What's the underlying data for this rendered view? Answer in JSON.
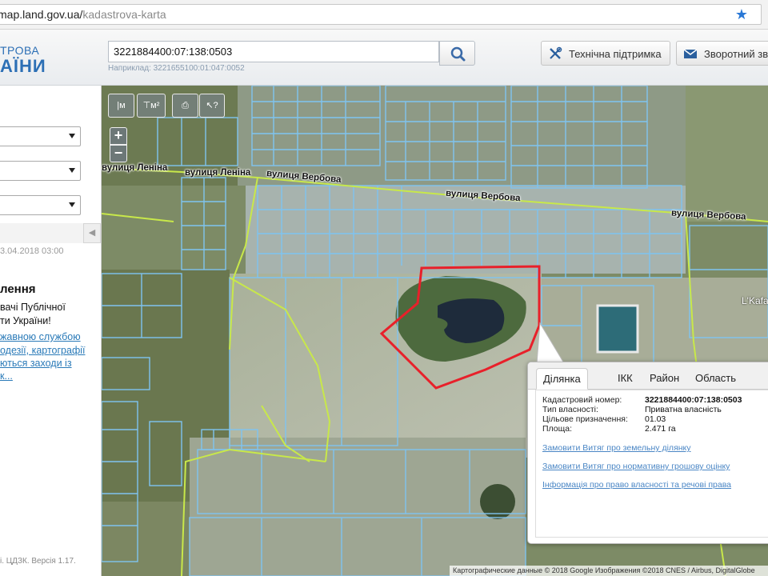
{
  "browser": {
    "url_domain": "map.land.gov.ua/",
    "url_path": "kadastrova-karta"
  },
  "header": {
    "logo_line1": "ТРОВА",
    "logo_line2": "АЇНИ",
    "search_value": "3221884400:07:138:0503",
    "search_example": "Наприклад: 3221655100:01:047:0052",
    "support_label": "Технічна підтримка",
    "feedback_label": "Зворотний зв'"
  },
  "left_panel": {
    "updated_date": "3.04.2018 03:00",
    "notice_title": "лення",
    "notice_line1": "вачі Публічної",
    "notice_line2": "ти України!",
    "notice_link1": "жавною службою",
    "notice_link2": "одезії, картографії",
    "notice_link3": "ються заходи із",
    "notice_link4": "к...",
    "footer": "і. ЦДЗК. Версія 1.17."
  },
  "map": {
    "streets": [
      "вулиця Леніна",
      "вулиця Леніна",
      "вулиця Вербова",
      "вулиця Вербова",
      "вулиця Вербова"
    ],
    "place_label": "L'Kafa",
    "tools": [
      "м",
      "м²",
      "print",
      "info"
    ],
    "attribution": "Картографические данные © 2018 Google Изображения ©2018 CNES / Airbus, DigitalGlobe"
  },
  "popup": {
    "tabs": [
      "Ділянка",
      "ІКК",
      "Район",
      "Область"
    ],
    "active_tab": "Ділянка",
    "properties": [
      {
        "label": "Кадастровий номер:",
        "value": "3221884400:07:138:0503"
      },
      {
        "label": "Тип власності:",
        "value": "Приватна власність"
      },
      {
        "label": "Цільове призначення:",
        "value": "01.03"
      },
      {
        "label": "Площа:",
        "value": "2.471 га"
      }
    ],
    "links": [
      "Замовити Витяг про земельну ділянку",
      "Замовити Витяг про нормативну грошову оцінку",
      "Інформація про право власності та речові права"
    ]
  },
  "colors": {
    "parcel_outline": "#7fc4f0",
    "selected_outline": "#e8202a",
    "boundary_green": "#c8e84a",
    "link": "#4a86c5"
  }
}
